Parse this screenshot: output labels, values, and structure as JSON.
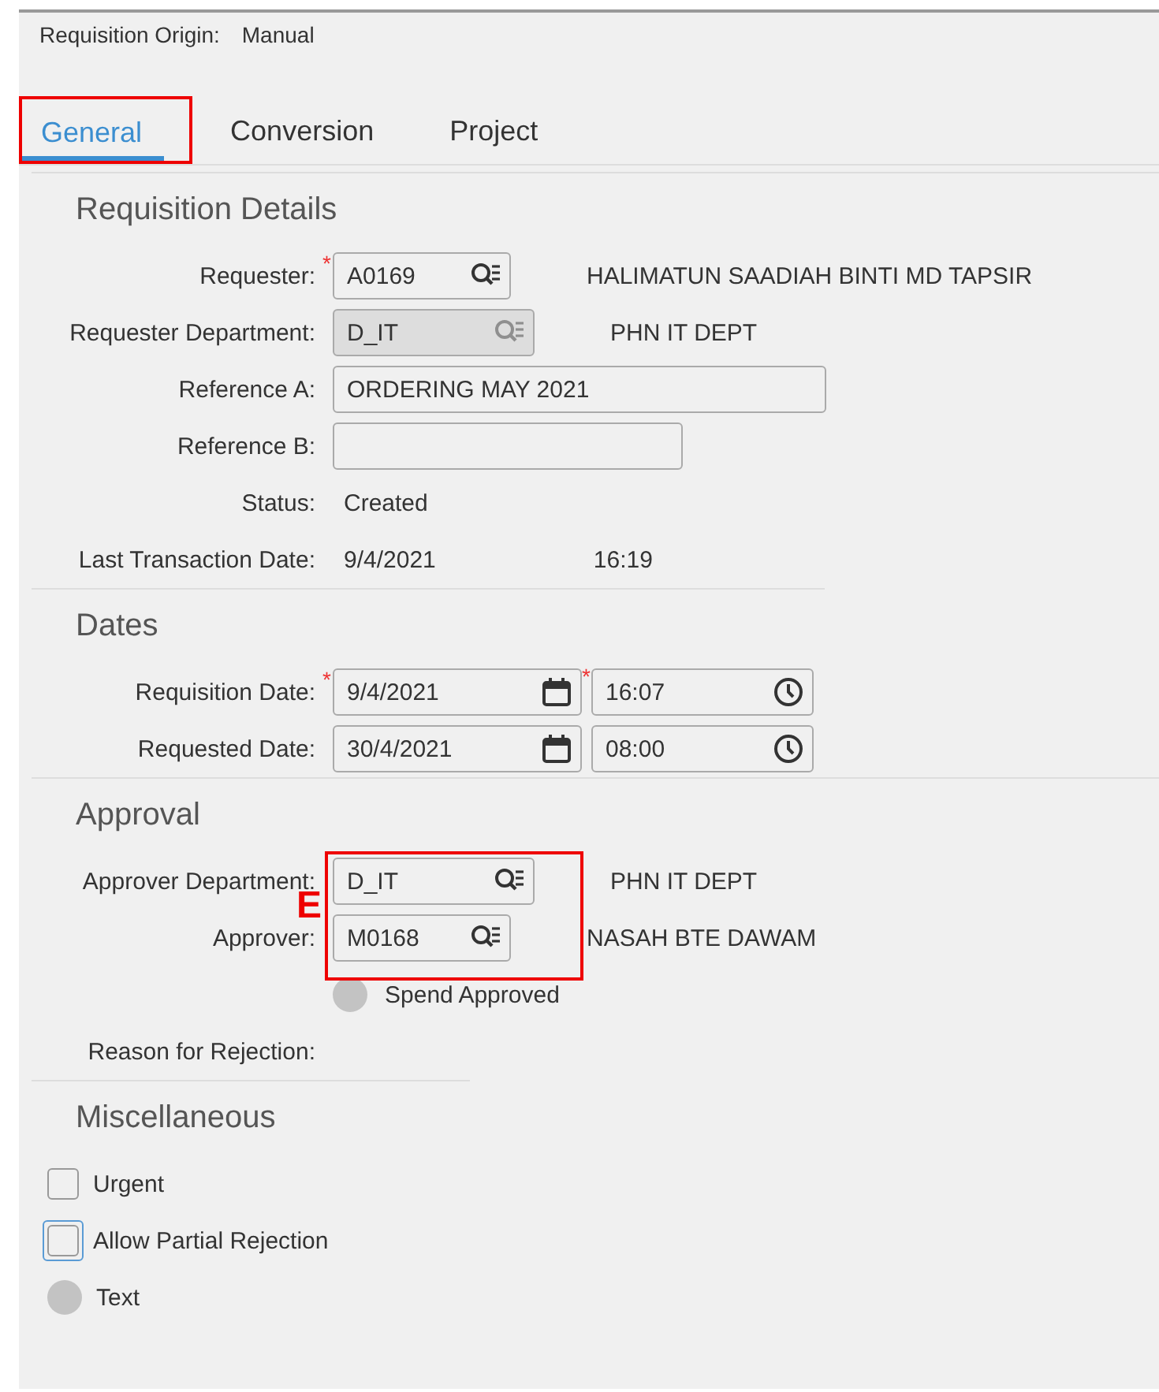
{
  "origin": {
    "label": "Requisition Origin:",
    "value": "Manual"
  },
  "tabs": [
    {
      "label": "General",
      "selected": true,
      "outlined": true
    },
    {
      "label": "Conversion",
      "selected": false,
      "outlined": false
    },
    {
      "label": "Project",
      "selected": false,
      "outlined": false
    }
  ],
  "sections": [
    {
      "title": "Requisition Details",
      "rows": [
        {
          "kind": "lookup",
          "label": "Requester:",
          "required_mark": "*",
          "disabled": false,
          "value": "A0169",
          "description": "HALIMATUN SAADIAH BINTI MD TAPSIR"
        },
        {
          "kind": "lookup",
          "label": "Requester Department:",
          "disabled": true,
          "value": "D_IT",
          "description": "PHN IT DEPT"
        },
        {
          "kind": "text",
          "label": "Reference A:",
          "value": "ORDERING MAY 2021"
        },
        {
          "kind": "text",
          "label": "Reference B:"
        },
        {
          "kind": "display",
          "label": "Status:",
          "value": "Created"
        },
        {
          "kind": "display",
          "label": "Last Transaction Date:",
          "value": "9/4/2021",
          "extra": "16:19"
        }
      ]
    },
    {
      "title": "Dates",
      "rows": [
        {
          "kind": "datetime",
          "label": "Requisition Date:",
          "required_mark": "*",
          "date": "9/4/2021",
          "time_required_mark": "*",
          "time": "16:07"
        },
        {
          "kind": "datetime",
          "label": "Requested Date:",
          "date": "30/4/2021",
          "time": "08:00"
        }
      ]
    },
    {
      "title": "Approval",
      "annotation": "E",
      "rows": [
        {
          "kind": "lookup",
          "label": "Approver Department:",
          "disabled": false,
          "value": "D_IT",
          "description": "PHN IT DEPT",
          "outlined": true
        },
        {
          "kind": "lookup",
          "label": "Approver:",
          "disabled": false,
          "value": "M0168",
          "description": "NASAH BTE DAWAM",
          "outlined": true
        },
        {
          "kind": "radio",
          "label": "Spend Approved",
          "selected": false
        },
        {
          "kind": "display",
          "label": "Reason for Rejection:"
        }
      ]
    },
    {
      "title": "Miscellaneous",
      "rows": [
        {
          "kind": "checkbox",
          "label": "Urgent",
          "checked": false,
          "focused": false
        },
        {
          "kind": "checkbox",
          "label": "Allow Partial Rejection",
          "checked": false,
          "focused": true
        },
        {
          "kind": "plainradio",
          "label": "Text",
          "selected": false
        }
      ]
    }
  ]
}
